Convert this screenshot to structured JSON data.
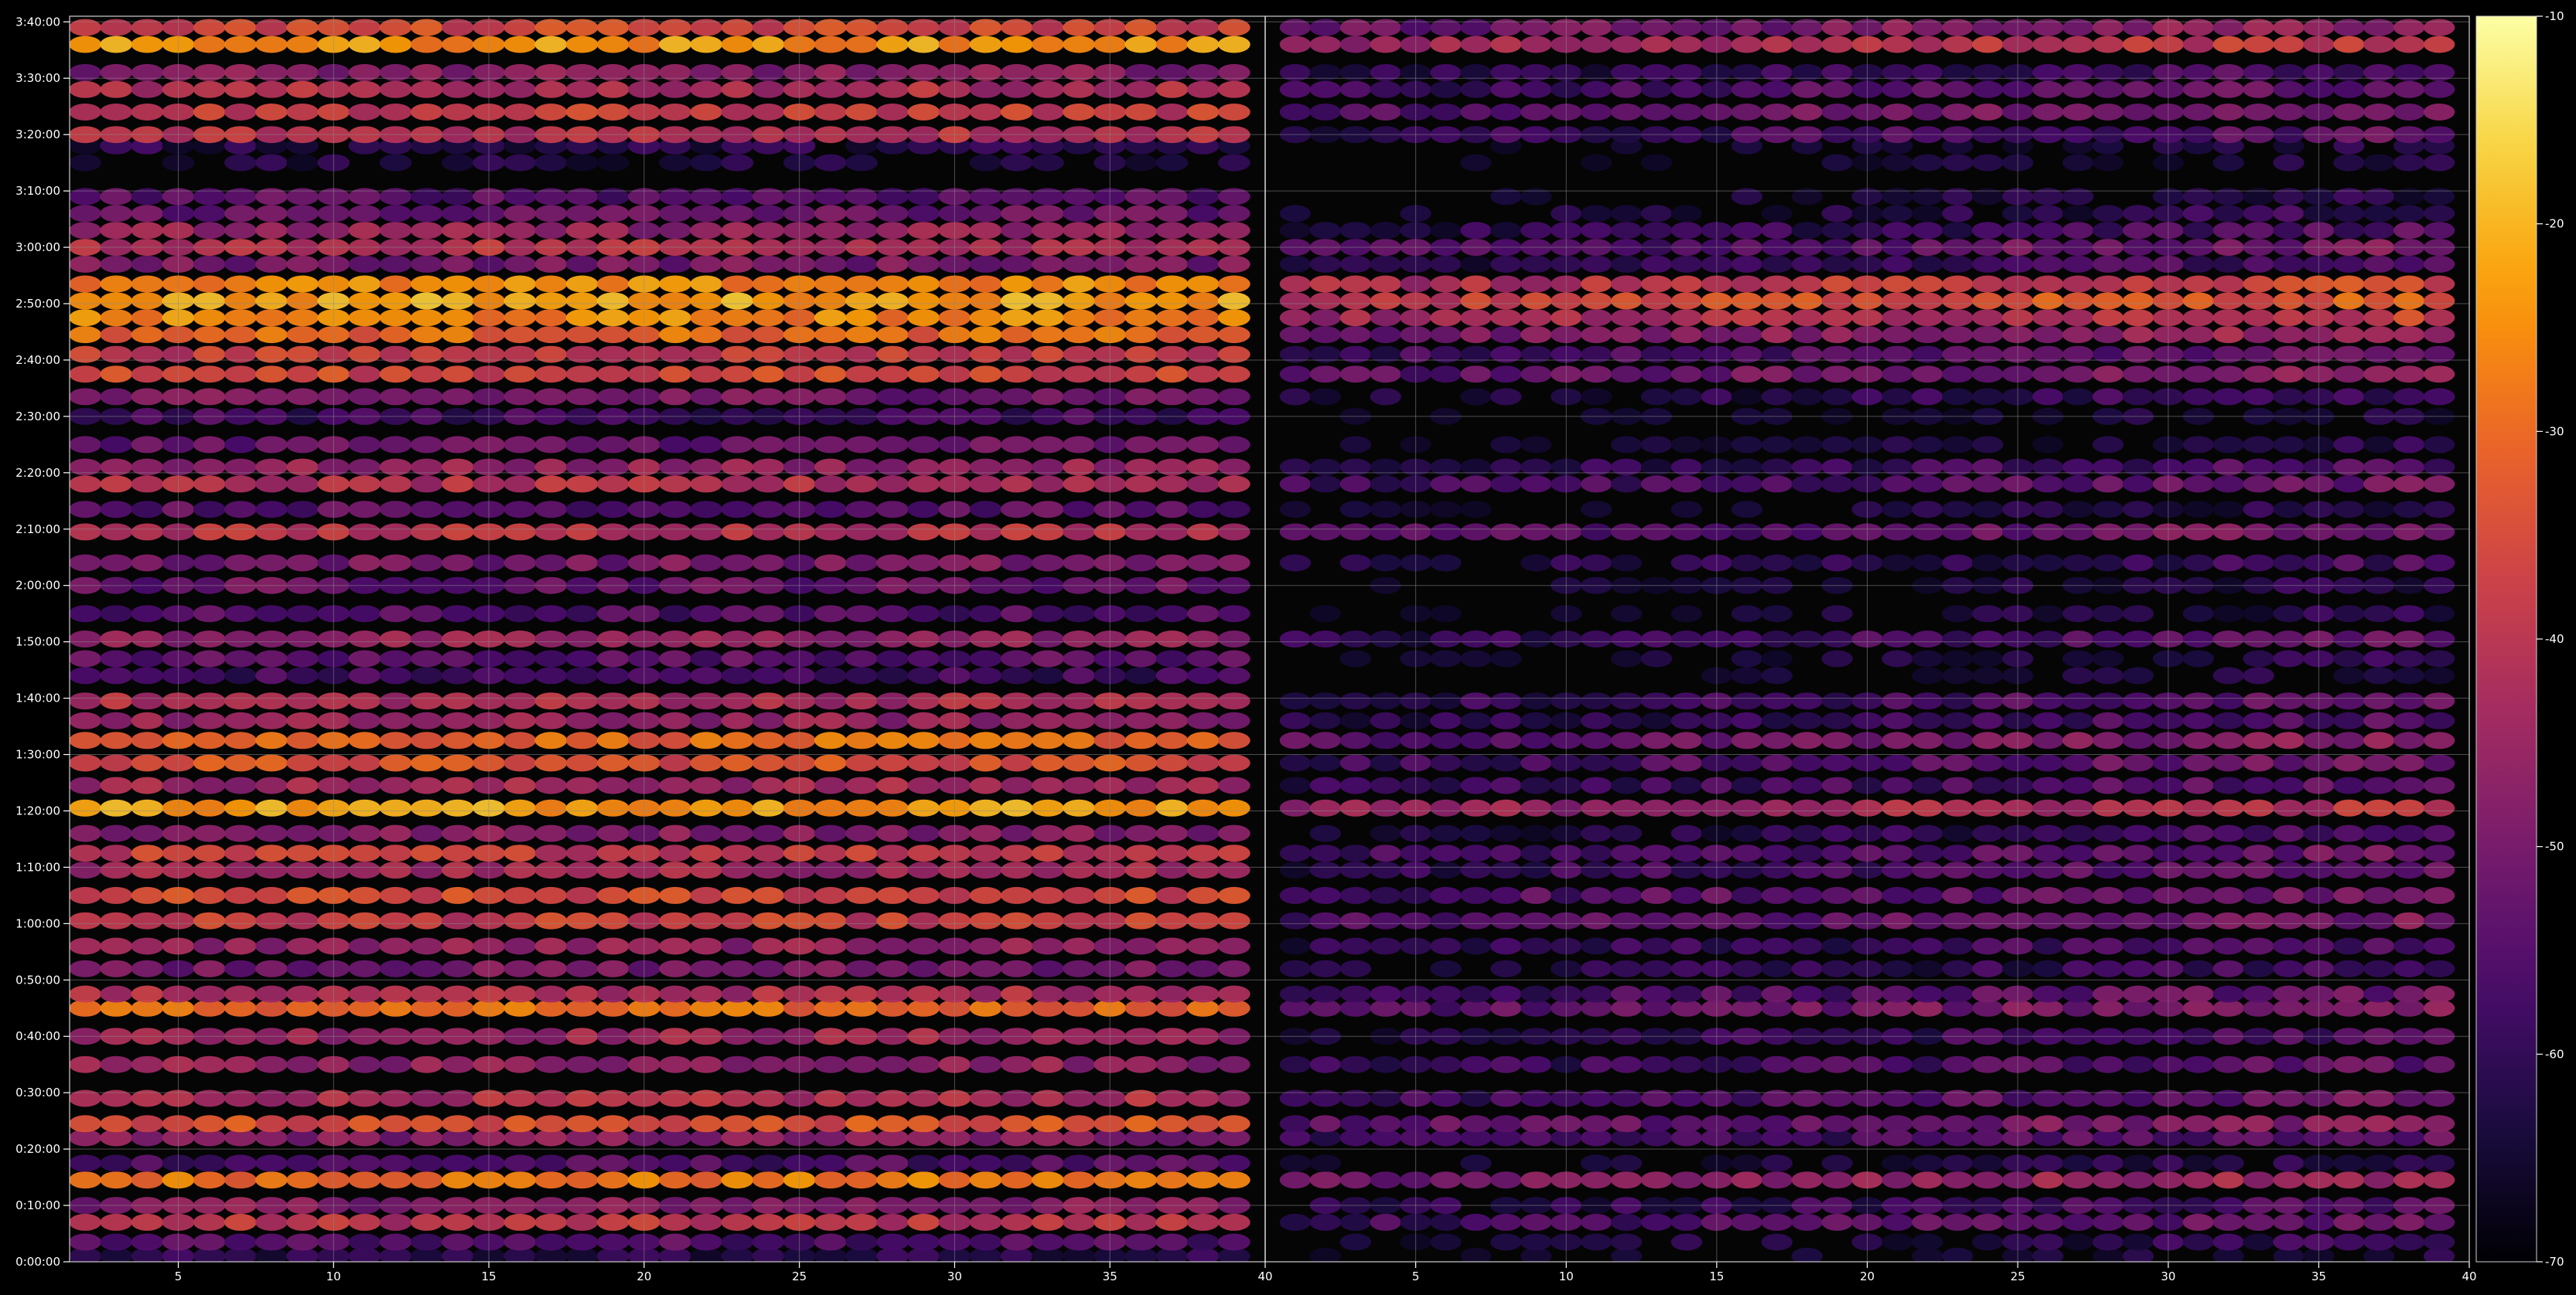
{
  "chart_data": {
    "type": "heatmap",
    "title": "",
    "xlabel": "",
    "ylabel": "",
    "grid": true,
    "legend": "none",
    "colormap": "inferno",
    "colormap_stops": [
      "#000004",
      "#1b0c41",
      "#4a0c6b",
      "#781c6d",
      "#a52c60",
      "#cf4446",
      "#ed6925",
      "#fb9b06",
      "#f7d13d",
      "#fcffa4"
    ],
    "background": "#050505",
    "grid_color": "#8a8a8a",
    "text_color": "#ffffff",
    "panels": [
      {
        "name": "left",
        "xlim": [
          1.5,
          40
        ],
        "xticks": [
          "5",
          "10",
          "15",
          "20",
          "25",
          "30",
          "35",
          "40"
        ],
        "xtick_values": [
          5,
          10,
          15,
          20,
          25,
          30,
          35,
          40
        ]
      },
      {
        "name": "right",
        "xlim": [
          0,
          40
        ],
        "xticks": [
          "5",
          "10",
          "15",
          "20",
          "25",
          "30",
          "35",
          "40"
        ],
        "xtick_values": [
          5,
          10,
          15,
          20,
          25,
          30,
          35,
          40
        ]
      }
    ],
    "ylim_minutes": [
      0,
      221
    ],
    "yticks": [
      "0:00:00",
      "0:10:00",
      "0:20:00",
      "0:30:00",
      "0:40:00",
      "0:50:00",
      "1:00:00",
      "1:10:00",
      "1:20:00",
      "1:30:00",
      "1:40:00",
      "1:50:00",
      "2:00:00",
      "2:10:00",
      "2:20:00",
      "2:30:00",
      "2:40:00",
      "2:50:00",
      "3:00:00",
      "3:10:00",
      "3:20:00",
      "3:30:00",
      "3:40:00"
    ],
    "ytick_minutes": [
      0,
      10,
      20,
      30,
      40,
      50,
      60,
      70,
      80,
      90,
      100,
      110,
      120,
      130,
      140,
      150,
      160,
      170,
      180,
      190,
      200,
      210,
      220
    ],
    "colorbar": {
      "min": -70,
      "max": -10,
      "ticks": [
        "-10",
        "-20",
        "-30",
        "-40",
        "-50",
        "-60",
        "-70"
      ],
      "tick_values": [
        -10,
        -20,
        -30,
        -40,
        -50,
        -60,
        -70
      ]
    },
    "row_levels_left": [
      {
        "t": 1,
        "v": -62
      },
      {
        "t": 3.5,
        "v": -55
      },
      {
        "t": 7,
        "v": -40
      },
      {
        "t": 10,
        "v": -48
      },
      {
        "t": 14.5,
        "v": -28
      },
      {
        "t": 17.5,
        "v": -56
      },
      {
        "t": 22,
        "v": -48
      },
      {
        "t": 24.5,
        "v": -34
      },
      {
        "t": 29,
        "v": -42
      },
      {
        "t": 35,
        "v": -46
      },
      {
        "t": 40,
        "v": -44
      },
      {
        "t": 45,
        "v": -30
      },
      {
        "t": 47.5,
        "v": -42
      },
      {
        "t": 52,
        "v": -50
      },
      {
        "t": 56,
        "v": -46
      },
      {
        "t": 60.5,
        "v": -38
      },
      {
        "t": 65,
        "v": -36
      },
      {
        "t": 69.5,
        "v": -44
      },
      {
        "t": 72.5,
        "v": -38
      },
      {
        "t": 76,
        "v": -48
      },
      {
        "t": 80.5,
        "v": -22
      },
      {
        "t": 84.5,
        "v": -44
      },
      {
        "t": 88.5,
        "v": -34
      },
      {
        "t": 92.5,
        "v": -30
      },
      {
        "t": 96,
        "v": -46
      },
      {
        "t": 99.5,
        "v": -42
      },
      {
        "t": 104,
        "v": -58
      },
      {
        "t": 107,
        "v": -54
      },
      {
        "t": 110.5,
        "v": -46
      },
      {
        "t": 115,
        "v": -56
      },
      {
        "t": 120,
        "v": -52
      },
      {
        "t": 124,
        "v": -50
      },
      {
        "t": 129.5,
        "v": -40
      },
      {
        "t": 133.5,
        "v": -54
      },
      {
        "t": 138,
        "v": -42
      },
      {
        "t": 141,
        "v": -46
      },
      {
        "t": 145,
        "v": -52
      },
      {
        "t": 150,
        "v": -58
      },
      {
        "t": 153.5,
        "v": -50
      },
      {
        "t": 157.5,
        "v": -36
      },
      {
        "t": 161,
        "v": -38
      },
      {
        "t": 164.5,
        "v": -30
      },
      {
        "t": 167.5,
        "v": -26
      },
      {
        "t": 170.5,
        "v": -22
      },
      {
        "t": 173.5,
        "v": -26
      },
      {
        "t": 177,
        "v": -50
      },
      {
        "t": 180,
        "v": -40
      },
      {
        "t": 183,
        "v": -46
      },
      {
        "t": 186,
        "v": -52
      },
      {
        "t": 189,
        "v": -54
      },
      {
        "t": 195,
        "v": -64
      },
      {
        "t": 198,
        "v": -62
      },
      {
        "t": 200,
        "v": -40
      },
      {
        "t": 204,
        "v": -38
      },
      {
        "t": 208,
        "v": -42
      },
      {
        "t": 211,
        "v": -48
      },
      {
        "t": 216,
        "v": -24
      },
      {
        "t": 219,
        "v": -36
      }
    ],
    "row_levels_right": [
      {
        "t": 1,
        "v": -68
      },
      {
        "t": 3.5,
        "v": -64
      },
      {
        "t": 7,
        "v": -56
      },
      {
        "t": 10,
        "v": -60
      },
      {
        "t": 14.5,
        "v": -48
      },
      {
        "t": 17.5,
        "v": -66
      },
      {
        "t": 22,
        "v": -58
      },
      {
        "t": 24.5,
        "v": -52
      },
      {
        "t": 29,
        "v": -56
      },
      {
        "t": 35,
        "v": -58
      },
      {
        "t": 40,
        "v": -60
      },
      {
        "t": 45,
        "v": -52
      },
      {
        "t": 47.5,
        "v": -56
      },
      {
        "t": 52,
        "v": -62
      },
      {
        "t": 56,
        "v": -60
      },
      {
        "t": 60.5,
        "v": -54
      },
      {
        "t": 65,
        "v": -54
      },
      {
        "t": 69.5,
        "v": -58
      },
      {
        "t": 72.5,
        "v": -56
      },
      {
        "t": 76,
        "v": -62
      },
      {
        "t": 80.5,
        "v": -44
      },
      {
        "t": 84.5,
        "v": -58
      },
      {
        "t": 88.5,
        "v": -56
      },
      {
        "t": 92.5,
        "v": -52
      },
      {
        "t": 96,
        "v": -60
      },
      {
        "t": 99.5,
        "v": -58
      },
      {
        "t": 104,
        "v": -68
      },
      {
        "t": 107,
        "v": -66
      },
      {
        "t": 110.5,
        "v": -58
      },
      {
        "t": 115,
        "v": -66
      },
      {
        "t": 120,
        "v": -66
      },
      {
        "t": 124,
        "v": -62
      },
      {
        "t": 129.5,
        "v": -54
      },
      {
        "t": 133.5,
        "v": -66
      },
      {
        "t": 138,
        "v": -56
      },
      {
        "t": 141,
        "v": -60
      },
      {
        "t": 145,
        "v": -66
      },
      {
        "t": 150,
        "v": -68
      },
      {
        "t": 153.5,
        "v": -62
      },
      {
        "t": 157.5,
        "v": -52
      },
      {
        "t": 161,
        "v": -56
      },
      {
        "t": 164.5,
        "v": -48
      },
      {
        "t": 167.5,
        "v": -42
      },
      {
        "t": 170.5,
        "v": -36
      },
      {
        "t": 173.5,
        "v": -40
      },
      {
        "t": 177,
        "v": -60
      },
      {
        "t": 180,
        "v": -54
      },
      {
        "t": 183,
        "v": -60
      },
      {
        "t": 186,
        "v": -64
      },
      {
        "t": 189,
        "v": -66
      },
      {
        "t": 195,
        "v": -68
      },
      {
        "t": 198,
        "v": -68
      },
      {
        "t": 200,
        "v": -58
      },
      {
        "t": 204,
        "v": -52
      },
      {
        "t": 208,
        "v": -56
      },
      {
        "t": 211,
        "v": -60
      },
      {
        "t": 216,
        "v": -42
      },
      {
        "t": 219,
        "v": -50
      }
    ]
  }
}
